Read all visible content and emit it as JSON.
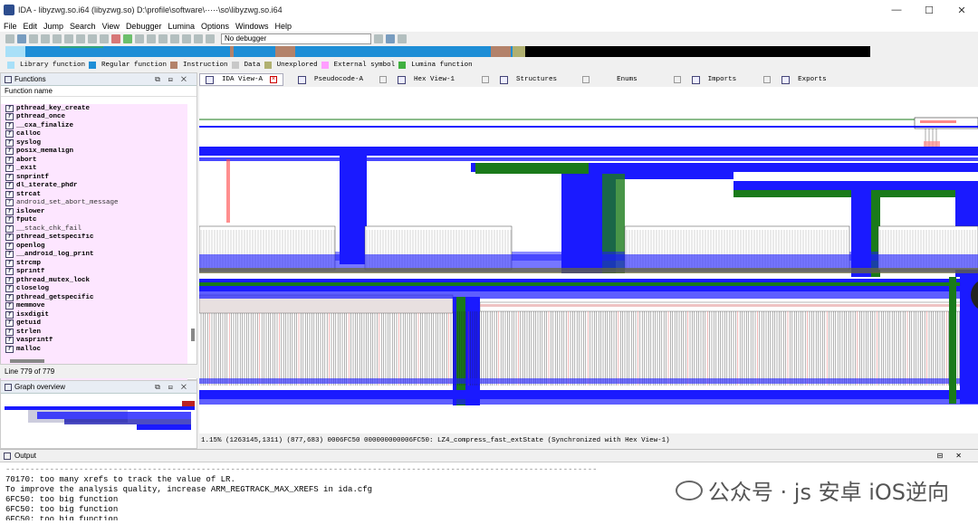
{
  "window": {
    "title": "IDA - libyzwg.so.i64 (libyzwg.so) D:\\profile\\software\\·····\\so\\libyzwg.so.i64",
    "min": "—",
    "max": "☐",
    "close": "✕"
  },
  "menu": [
    "File",
    "Edit",
    "Jump",
    "Search",
    "View",
    "Debugger",
    "Lumina",
    "Options",
    "Windows",
    "Help"
  ],
  "toolbar": {
    "debugger_select": "No debugger"
  },
  "legend": [
    {
      "label": "Library function",
      "color": "#a8e0f8"
    },
    {
      "label": "Regular function",
      "color": "#1e8ed6"
    },
    {
      "label": "Instruction",
      "color": "#b3826a"
    },
    {
      "label": "Data",
      "color": "#c8c8c8"
    },
    {
      "label": "Unexplored",
      "color": "#b0b070"
    },
    {
      "label": "External symbol",
      "color": "#ff9eff"
    },
    {
      "label": "Lumina function",
      "color": "#40b040"
    }
  ],
  "functions_panel": {
    "title": "Functions",
    "column_header": "Function name",
    "line_status": "Line 779 of 779",
    "items": [
      "pthread_key_create",
      "pthread_once",
      "__cxa_finalize",
      "calloc",
      "syslog",
      "posix_memalign",
      "abort",
      "_exit",
      "snprintf",
      "dl_iterate_phdr",
      "strcat",
      "android_set_abort_message",
      "islower",
      "fputc",
      "__stack_chk_fail",
      "pthread_setspecific",
      "openlog",
      "__android_log_print",
      "strcmp",
      "sprintf",
      "pthread_mutex_lock",
      "closelog",
      "pthread_getspecific",
      "memmove",
      "isxdigit",
      "getuid",
      "strlen",
      "vasprintf",
      "malloc"
    ]
  },
  "graph_overview": {
    "title": "Graph overview"
  },
  "tabs": [
    {
      "label": "IDA View-A",
      "active": true
    },
    {
      "label": "Pseudocode-A",
      "active": false
    },
    {
      "label": "Hex View-1",
      "active": false
    },
    {
      "label": "Structures",
      "active": false
    },
    {
      "label": "Enums",
      "active": false
    },
    {
      "label": "Imports",
      "active": false
    },
    {
      "label": "Exports",
      "active": false
    }
  ],
  "status_line": "1.15% (1263145,1311) (877,683) 0006FC50 000000000006FC50: LZ4_compress_fast_extState (Synchronized with Hex View-1)",
  "output": {
    "title": "Output",
    "lines": [
      "----------------------------------------------------------------------------------------------------------------------------",
      "70170: too many xrefs to track the value of LR.",
      "To improve the analysis quality, increase ARM_REGTRACK_MAX_XREFS in ida.cfg",
      "6FC50: too big function",
      "6FC50: too big function",
      "6FC50: too big function"
    ]
  },
  "watermark": "公众号 · js 安卓 iOS逆向"
}
